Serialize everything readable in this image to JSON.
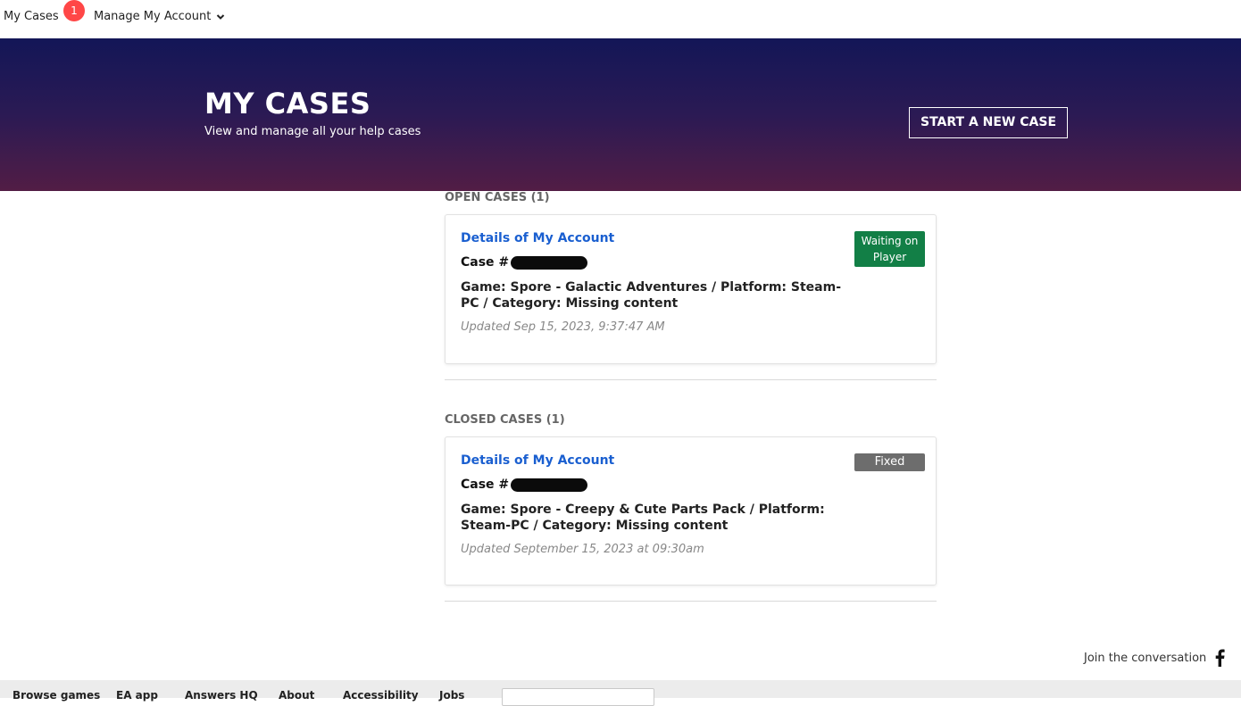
{
  "nav": {
    "my_cases": "My Cases",
    "badge_count": "1",
    "manage_account": "Manage My Account"
  },
  "hero": {
    "title": "MY CASES",
    "subtitle": "View and manage all your help cases",
    "new_case_button": "START A NEW CASE"
  },
  "open_cases": {
    "label": "OPEN CASES (1)",
    "cases": [
      {
        "title": "Details of My Account",
        "case_prefix": "Case #",
        "description": "Game: Spore - Galactic Adventures / Platform: Steam-PC / Category: Missing content",
        "updated": "Updated Sep 15, 2023, 9:37:47 AM",
        "status": "Waiting on Player",
        "status_color": "#127f46"
      }
    ]
  },
  "closed_cases": {
    "label": "CLOSED CASES (1)",
    "cases": [
      {
        "title": "Details of My Account",
        "case_prefix": "Case #",
        "description": "Game: Spore - Creepy & Cute Parts Pack / Platform: Steam-PC / Category: Missing content",
        "updated": "Updated September 15, 2023 at 09:30am",
        "status": "Fixed",
        "status_color": "#6d6d6d"
      }
    ]
  },
  "social": {
    "join_text": "Join the conversation",
    "icon": "facebook-icon"
  },
  "footer": {
    "links": [
      "Browse games",
      "EA app",
      "Answers HQ",
      "About",
      "Accessibility",
      "Jobs"
    ]
  },
  "colors": {
    "link_blue": "#1a5fd0",
    "badge_red": "#ff4747",
    "hero_top": "#131657",
    "hero_bottom": "#521d45"
  }
}
